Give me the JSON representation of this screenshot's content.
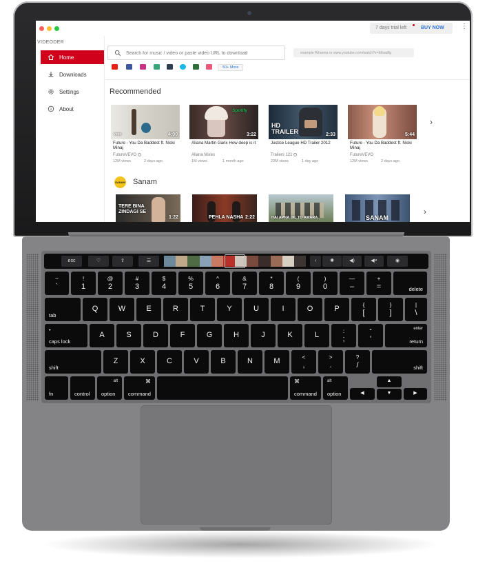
{
  "app": {
    "brand": "VIDEODER",
    "trial_text": "7 days trial left",
    "buy_now_label": "BUY NOW",
    "menu_icon": "kebab-menu-icon"
  },
  "sidebar": {
    "items": [
      {
        "label": "Home",
        "icon": "home-icon",
        "active": true
      },
      {
        "label": "Downloads",
        "icon": "download-icon",
        "active": false
      },
      {
        "label": "Settings",
        "icon": "gear-icon",
        "active": false
      },
      {
        "label": "About",
        "icon": "info-icon",
        "active": false
      }
    ]
  },
  "search": {
    "placeholder": "Search for music / video or paste video URL to download",
    "value": "",
    "example": "example Rihanna or www.youtube.com/watch?v=fdfsadfg"
  },
  "sites": {
    "icons": [
      {
        "name": "youtube-icon",
        "color": "#e62117"
      },
      {
        "name": "facebook-icon",
        "color": "#3b5998"
      },
      {
        "name": "instagram-icon",
        "color": "#c13584"
      },
      {
        "name": "site-green-icon",
        "color": "#3aa57a"
      },
      {
        "name": "site-dark-icon",
        "color": "#2d3e50"
      },
      {
        "name": "vimeo-icon",
        "color": "#1ab7ea"
      },
      {
        "name": "site-darkgreen-icon",
        "color": "#2f6e3b"
      },
      {
        "name": "site-multicolor-icon",
        "color": "#e85a7a"
      }
    ],
    "more_label": "50+ More"
  },
  "recommended": {
    "title": "Recommended",
    "videos": [
      {
        "title": "Future - You Da Baddest ft. Nicki Minaj",
        "channel": "FutureVEVO",
        "views": "12M views",
        "ago": "2 days ago",
        "duration": "4:00",
        "verified": true
      },
      {
        "title": "Aliana Martin Garix How deep is it",
        "channel": "Aliana Mixes",
        "views": "1M views",
        "ago": "1 month ago",
        "duration": "3:22",
        "verified": false
      },
      {
        "title": "Justice League HD Trailer 2012",
        "channel": "Trailers 121",
        "views": "22M views",
        "ago": "1 day ago",
        "duration": "2:33",
        "verified": true
      },
      {
        "title": "Future - You Da Baddest ft. Nicki Minaj",
        "channel": "FutureVEVO",
        "views": "12M views",
        "ago": "2 days ago",
        "duration": "5:44",
        "verified": false
      }
    ],
    "thumb_labels": {
      "spotify": "Spotify",
      "trailer": "HD TRAILER",
      "vevo": "vevo"
    }
  },
  "artist": {
    "name": "Sanam",
    "thumbs": [
      {
        "text1": "TERE BINA",
        "text2": "ZINDAGI SE",
        "duration": "1:22"
      },
      {
        "text1": "PEHLA NASHA",
        "text2": "",
        "duration": "2:22"
      },
      {
        "text1": "HAI APNA DIL TO AWARA",
        "text2": "",
        "duration": ""
      },
      {
        "text1": "SANAM",
        "text2": "",
        "duration": ""
      }
    ]
  },
  "touchbar": {
    "esc": "esc",
    "icons": [
      "heart-icon",
      "share-icon",
      "sliders-icon",
      "chevron-left-icon",
      "brightness-icon",
      "volume-icon",
      "mute-icon",
      "siri-icon"
    ]
  },
  "keyboard": {
    "row1": [
      {
        "top": "~",
        "main": "`"
      },
      {
        "top": "!",
        "main": "1"
      },
      {
        "top": "@",
        "main": "2"
      },
      {
        "top": "#",
        "main": "3"
      },
      {
        "top": "$",
        "main": "4"
      },
      {
        "top": "%",
        "main": "5"
      },
      {
        "top": "^",
        "main": "6"
      },
      {
        "top": "&",
        "main": "7"
      },
      {
        "top": "*",
        "main": "8"
      },
      {
        "top": "(",
        "main": "9"
      },
      {
        "top": ")",
        "main": "0"
      },
      {
        "top": "—",
        "main": "–"
      },
      {
        "top": "+",
        "main": "="
      }
    ],
    "delete": "delete",
    "tab": "tab",
    "row2": [
      "Q",
      "W",
      "E",
      "R",
      "T",
      "Y",
      "U",
      "I",
      "O",
      "P"
    ],
    "row2_sym": [
      {
        "top": "{",
        "main": "["
      },
      {
        "top": "}",
        "main": "]"
      },
      {
        "top": "|",
        "main": "\\"
      }
    ],
    "caps_lock": "caps lock",
    "caps_dot": "•",
    "row3": [
      "A",
      "S",
      "D",
      "F",
      "G",
      "H",
      "J",
      "K",
      "L"
    ],
    "row3_sym": [
      {
        "top": ":",
        "main": ";"
      },
      {
        "top": "\"",
        "main": "'"
      }
    ],
    "enter": "enter",
    "return": "return",
    "shift": "shift",
    "row4": [
      "Z",
      "X",
      "C",
      "V",
      "B",
      "N",
      "M"
    ],
    "row4_sym": [
      {
        "top": "<",
        "main": ","
      },
      {
        "top": ">",
        "main": "."
      },
      {
        "top": "?",
        "main": "/"
      }
    ],
    "fn": "fn",
    "control": "control",
    "alt": "alt",
    "option": "option",
    "cmd_symbol": "⌘",
    "command": "command",
    "arrows": {
      "left": "◀",
      "up": "▲",
      "down": "▼",
      "right": "▶"
    }
  }
}
